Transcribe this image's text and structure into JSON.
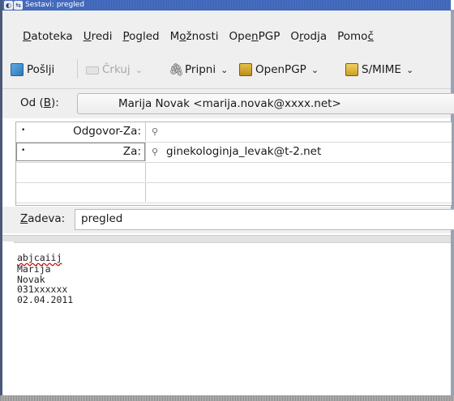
{
  "title": "Sestavi: pregled",
  "menu": [
    {
      "pre": "",
      "u": "D",
      "post": "atoteka"
    },
    {
      "pre": "",
      "u": "U",
      "post": "redi"
    },
    {
      "pre": "",
      "u": "P",
      "post": "ogled"
    },
    {
      "pre": "M",
      "u": "o",
      "post": "žnosti"
    },
    {
      "pre": "Ope",
      "u": "n",
      "post": "PGP"
    },
    {
      "pre": "O",
      "u": "r",
      "post": "odja"
    },
    {
      "pre": "Pomo",
      "u": "č",
      "post": ""
    }
  ],
  "toolbar": {
    "send": "Pošlji",
    "spell": "Črkuj",
    "attach": "Pripni",
    "openpgp": "OpenPGP",
    "smime": "S/MIME"
  },
  "from": {
    "label_pre": "Od (",
    "label_u": "B",
    "label_post": "):",
    "value": "Marija Novak <marija.novak@xxxx.net>"
  },
  "recipients": [
    {
      "type": "Odgovor-Za:",
      "address": ""
    },
    {
      "type": "Za:",
      "address": "ginekologinja_levak@t-2.net"
    }
  ],
  "subject": {
    "label_u": "Z",
    "label_post": "adeva:",
    "value": "pregled"
  },
  "body": {
    "lines": [
      "abjcaiij",
      "Marija",
      "Novak",
      "031xxxxxx",
      "02.04.2011"
    ]
  },
  "colors": {
    "titlebar": "#4a71c4",
    "chrome": "#efefef",
    "spell_error": "#d00000"
  }
}
